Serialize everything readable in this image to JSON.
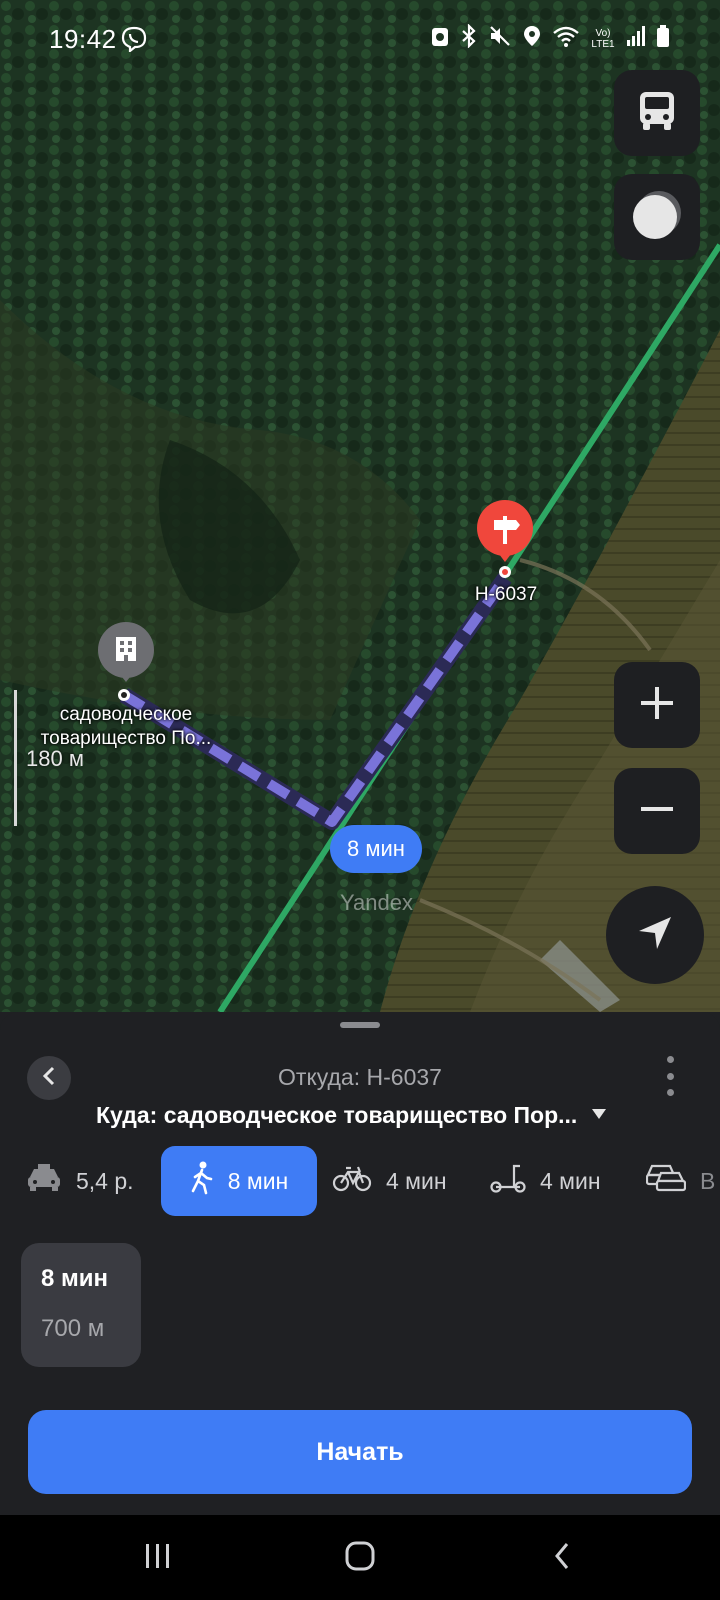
{
  "status_bar": {
    "time": "19:42",
    "network_label": "Vo) LTE1"
  },
  "map": {
    "origin_marker_label": "Н-6037",
    "destination_marker_label": "садоводческое товарищество По...",
    "route_time_chip": "8 мин",
    "scale_label": "180 м",
    "watermark": "Yandex",
    "colors": {
      "route": "#7a73d9",
      "railway": "#2ea864",
      "pin_red": "#f0473c",
      "accent": "#3f7cf5"
    }
  },
  "map_controls": [
    "bus-icon",
    "layers-icon",
    "zoom-in-icon",
    "zoom-out-icon",
    "location-arrow-icon"
  ],
  "route_panel": {
    "from": "Откуда: Н-6037",
    "to": "Куда: садоводческое товарищество Пор...",
    "modes": [
      {
        "icon": "taxi-icon",
        "label": "5,4 р."
      },
      {
        "icon": "walk-icon",
        "label": "8 мин",
        "active": true
      },
      {
        "icon": "bicycle-icon",
        "label": "4 мин"
      },
      {
        "icon": "scooter-icon",
        "label": "4 мин"
      },
      {
        "icon": "car-icon",
        "label": "В"
      }
    ],
    "route_option": {
      "time": "8 мин",
      "distance": "700 м"
    },
    "start_button": "Начать"
  },
  "nav_bar": [
    "recent-apps-icon",
    "home-icon",
    "back-icon"
  ]
}
